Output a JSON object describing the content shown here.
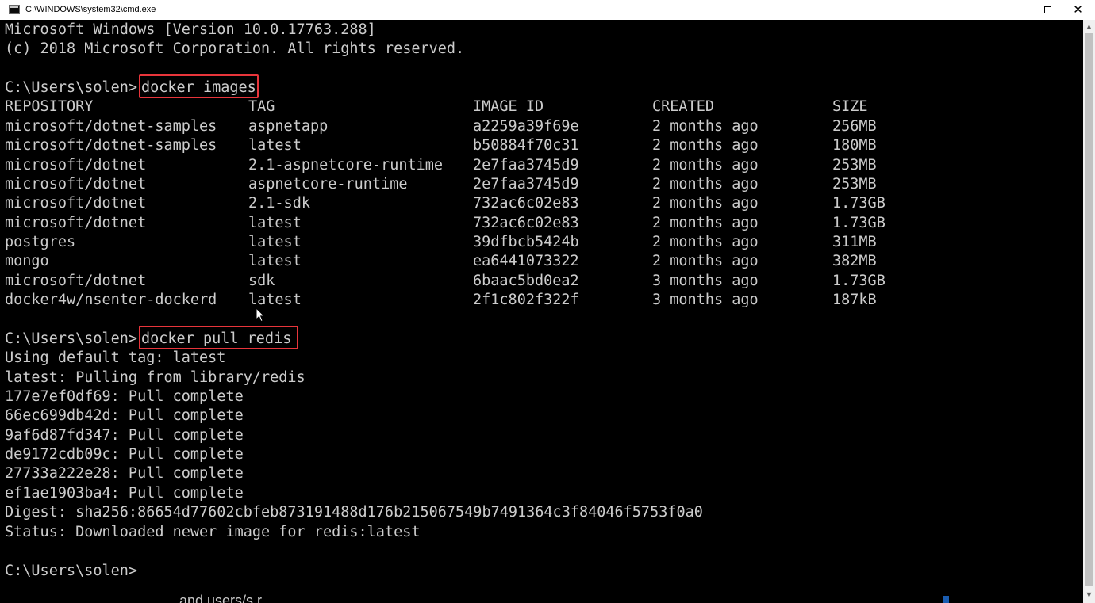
{
  "window": {
    "title": "C:\\WINDOWS\\system32\\cmd.exe",
    "icon": "cmd-icon",
    "controls": {
      "minimize": "minimize-icon",
      "maximize": "maximize-icon",
      "close": "close-icon",
      "close_glyph": "✕"
    }
  },
  "console": {
    "banner": [
      "Microsoft Windows [Version 10.0.17763.288]",
      "(c) 2018 Microsoft Corporation. All rights reserved."
    ],
    "prompt": "C:\\Users\\solen>",
    "command1": "docker images",
    "images_table": {
      "headers": [
        "REPOSITORY",
        "TAG",
        "IMAGE ID",
        "CREATED",
        "SIZE"
      ],
      "rows": [
        [
          "microsoft/dotnet-samples",
          "aspnetapp",
          "a2259a39f69e",
          "2 months ago",
          "256MB"
        ],
        [
          "microsoft/dotnet-samples",
          "latest",
          "b50884f70c31",
          "2 months ago",
          "180MB"
        ],
        [
          "microsoft/dotnet",
          "2.1-aspnetcore-runtime",
          "2e7faa3745d9",
          "2 months ago",
          "253MB"
        ],
        [
          "microsoft/dotnet",
          "aspnetcore-runtime",
          "2e7faa3745d9",
          "2 months ago",
          "253MB"
        ],
        [
          "microsoft/dotnet",
          "2.1-sdk",
          "732ac6c02e83",
          "2 months ago",
          "1.73GB"
        ],
        [
          "microsoft/dotnet",
          "latest",
          "732ac6c02e83",
          "2 months ago",
          "1.73GB"
        ],
        [
          "postgres",
          "latest",
          "39dfbcb5424b",
          "2 months ago",
          "311MB"
        ],
        [
          "mongo",
          "latest",
          "ea6441073322",
          "2 months ago",
          "382MB"
        ],
        [
          "microsoft/dotnet",
          "sdk",
          "6baac5bd0ea2",
          "3 months ago",
          "1.73GB"
        ],
        [
          "docker4w/nsenter-dockerd",
          "latest",
          "2f1c802f322f",
          "3 months ago",
          "187kB"
        ]
      ]
    },
    "command2": "docker pull redis",
    "pull_output": [
      "Using default tag: latest",
      "latest: Pulling from library/redis",
      "177e7ef0df69: Pull complete",
      "66ec699db42d: Pull complete",
      "9af6d87fd347: Pull complete",
      "de9172cdb09c: Pull complete",
      "27733a222e28: Pull complete",
      "ef1ae1903ba4: Pull complete",
      "Digest: sha256:86654d77602cbfeb873191488d176b215067549b7491364c3f84046f5753f0a0",
      "Status: Downloaded newer image for redis:latest"
    ],
    "text_color": "#cccccc",
    "background_color": "#000000",
    "highlight_color": "#e8353b"
  },
  "background_window": {
    "partial_text": "and users/s r"
  },
  "scrollbar": {
    "up_glyph": "▲",
    "down_glyph": "▼"
  }
}
